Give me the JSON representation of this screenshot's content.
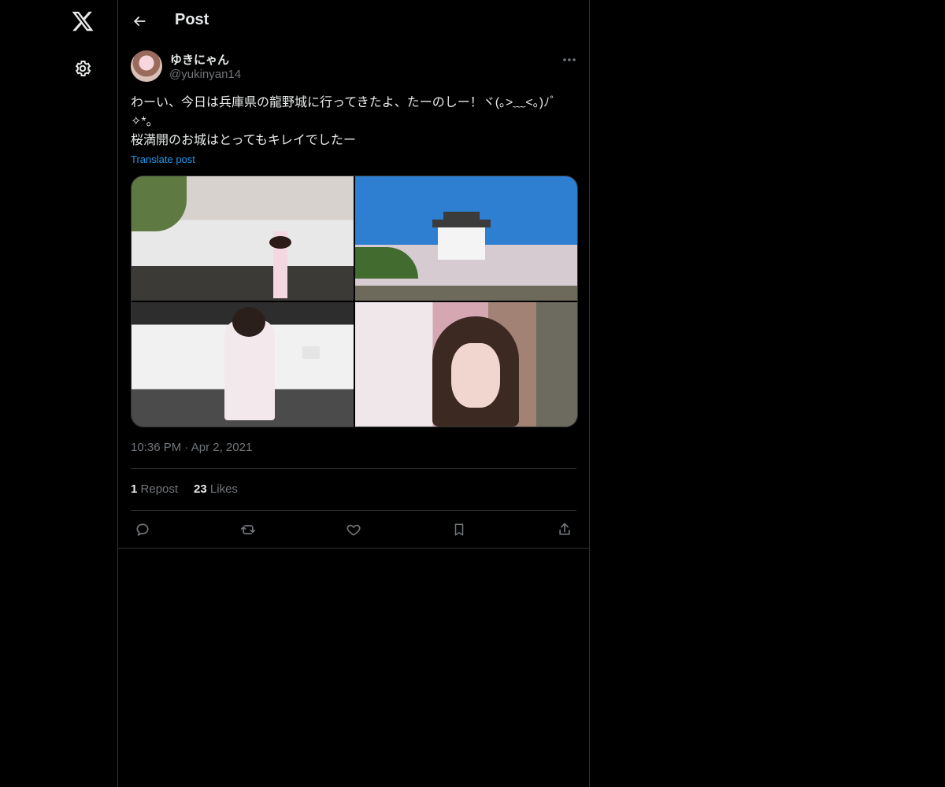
{
  "nav": {
    "logo_icon": "x-logo-icon",
    "settings_icon": "gear-icon"
  },
  "header": {
    "back_icon": "arrow-left-icon",
    "title": "Post"
  },
  "post": {
    "author": {
      "display_name": "ゆきにゃん",
      "handle": "@yukinyan14"
    },
    "more_icon": "ellipsis-icon",
    "text": "わーい、今日は兵庫県の龍野城に行ってきたよ、たーのしー！ヾ(｡>﹏<｡)ﾉﾞ✧*。\n桜満開のお城はとってもキレイでしたー",
    "translate_label": "Translate post",
    "media_count": 4,
    "time": "10:36 PM",
    "separator": "·",
    "date": "Apr 2, 2021",
    "stats": {
      "reposts_count": "1",
      "reposts_label": "Repost",
      "likes_count": "23",
      "likes_label": "Likes"
    },
    "actions": [
      "reply-icon",
      "repost-icon",
      "like-icon",
      "bookmark-icon",
      "share-icon"
    ]
  },
  "colors": {
    "background": "#000000",
    "text": "#e7e9ea",
    "muted": "#71767b",
    "accent": "#1d9bf0",
    "border": "#2f3336"
  }
}
